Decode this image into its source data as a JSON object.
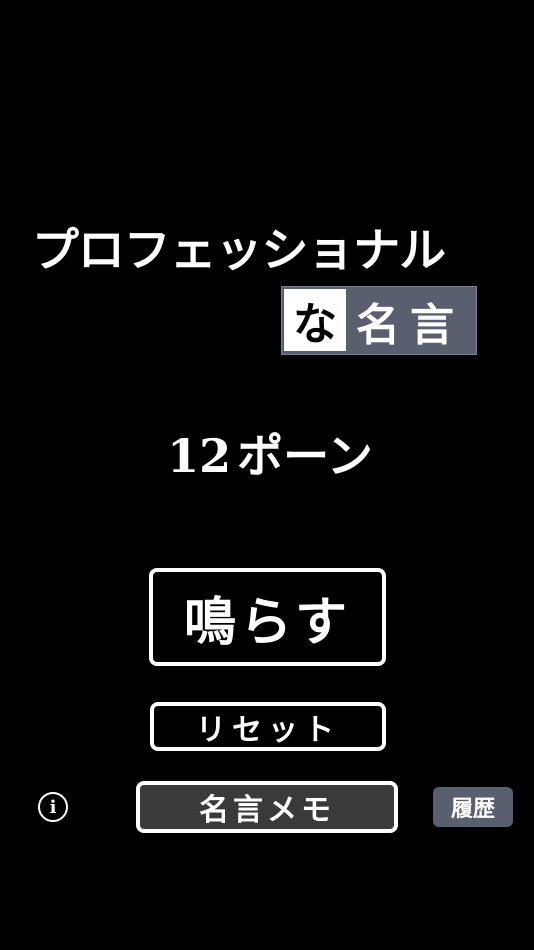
{
  "logo": {
    "line1": "プロフェッショナル",
    "na": "な",
    "meigen": "名言"
  },
  "counter": {
    "value": "12",
    "unit": "ポーン"
  },
  "buttons": {
    "ring_label": "鳴らす",
    "reset_label": "リセット",
    "memo_label": "名言メモ",
    "history_label": "履歴",
    "info_glyph": "i"
  },
  "colors": {
    "background": "#000000",
    "accent_slate": "#5a5f70",
    "memo_fill": "#3a3a3a",
    "text": "#ffffff"
  }
}
